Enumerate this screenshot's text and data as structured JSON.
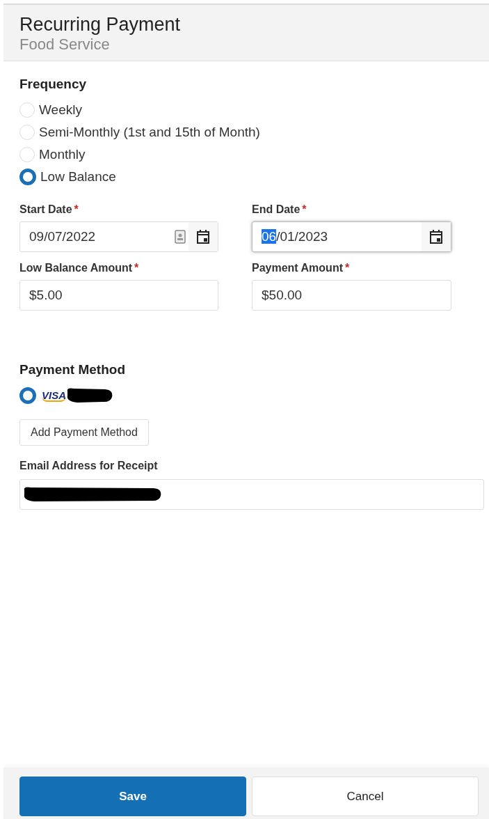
{
  "header": {
    "title": "Recurring Payment",
    "subtitle": "Food Service"
  },
  "frequency": {
    "label": "Frequency",
    "options": [
      {
        "label": "Weekly",
        "selected": false
      },
      {
        "label": "Semi-Monthly (1st and 15th of Month)",
        "selected": false
      },
      {
        "label": "Monthly",
        "selected": false
      },
      {
        "label": "Low Balance",
        "selected": true
      }
    ]
  },
  "fields": [
    {
      "kind": "date",
      "label": "Start Date",
      "required": "*",
      "value": "09/07/2022",
      "focused": false,
      "card_icon": true
    },
    {
      "kind": "date",
      "label": "End Date",
      "required": "*",
      "selection": "06",
      "value": "/01/2023",
      "focused": true,
      "card_icon": false
    },
    {
      "kind": "text",
      "label": "Low Balance Amount",
      "required": "*",
      "value": "$5.00",
      "focused": false
    },
    {
      "kind": "text",
      "label": "Payment Amount",
      "required": "*",
      "value": "$50.00",
      "focused": false
    }
  ],
  "payment_method": {
    "label": "Payment Method",
    "methods": [
      {
        "brand": "VISA",
        "selected": true,
        "redacted": true
      }
    ],
    "add_button": "Add Payment Method"
  },
  "email": {
    "label": "Email Address for Receipt",
    "redacted": true
  },
  "footer": {
    "buttons": [
      {
        "label": "Save",
        "primary": true
      },
      {
        "label": "Cancel",
        "primary": false
      }
    ]
  }
}
